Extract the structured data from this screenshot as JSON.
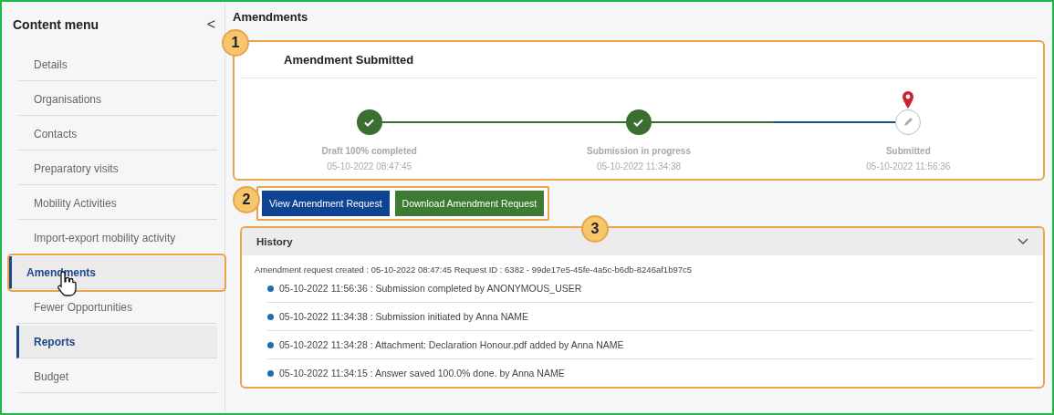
{
  "sidebar": {
    "title": "Content menu",
    "collapse_icon": "<",
    "items": [
      {
        "label": "Details",
        "selected": false,
        "highlighted": false
      },
      {
        "label": "Organisations",
        "selected": false,
        "highlighted": false
      },
      {
        "label": "Contacts",
        "selected": false,
        "highlighted": false
      },
      {
        "label": "Preparatory visits",
        "selected": false,
        "highlighted": false
      },
      {
        "label": "Mobility Activities",
        "selected": false,
        "highlighted": false
      },
      {
        "label": "Import-export mobility activity",
        "selected": false,
        "highlighted": false
      },
      {
        "label": "Amendments",
        "selected": true,
        "highlighted": true,
        "pointer": true
      },
      {
        "label": "Fewer Opportunities",
        "selected": false,
        "highlighted": false
      },
      {
        "label": "Reports",
        "selected": true,
        "highlighted": false
      },
      {
        "label": "Budget",
        "selected": false,
        "highlighted": false
      }
    ]
  },
  "page_title": "Amendments",
  "status_card": {
    "callout": "1",
    "title": "Amendment Submitted",
    "steps": [
      {
        "label": "Draft 100% completed",
        "date": "05-10-2022 08:47:45",
        "completed": true,
        "current": false
      },
      {
        "label": "Submission in progress",
        "date": "05-10-2022 11:34:38",
        "completed": true,
        "current": false
      },
      {
        "label": "Submitted",
        "date": "05-10-2022 11:56:36",
        "completed": false,
        "current": true
      }
    ]
  },
  "actions": {
    "callout": "2",
    "buttons": [
      {
        "label": "View Amendment Request",
        "kind": "primary"
      },
      {
        "label": "Download Amendment Request",
        "kind": "success"
      }
    ]
  },
  "history": {
    "callout": "3",
    "title": "History",
    "expanded": true,
    "summary": "Amendment request created : 05-10-2022 08:47:45 Request ID : 6382 - 99de17e5-45fe-4a5c-b6db-8246af1b97c5",
    "entries": [
      "05-10-2022 11:56:36 : Submission completed by ANONYMOUS_USER",
      "05-10-2022 11:34:38 : Submission initiated by Anna NAME",
      "05-10-2022 11:34:28 : Attachment: Declaration Honour.pdf added by Anna NAME",
      "05-10-2022 11:34:15 : Answer saved 100.0% done. by Anna NAME"
    ]
  }
}
